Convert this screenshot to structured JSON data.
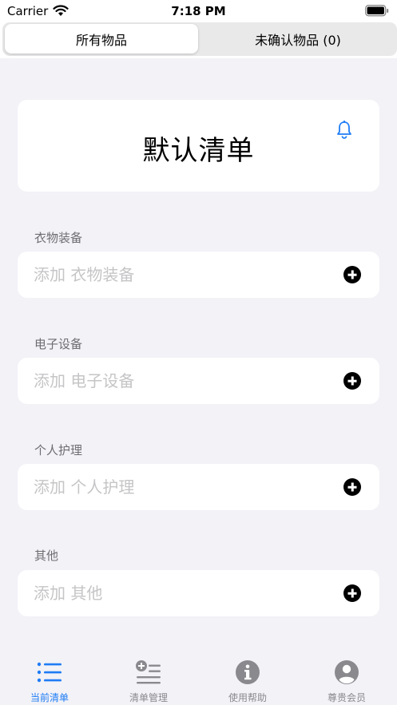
{
  "status_bar": {
    "carrier": "Carrier",
    "time": "7:18 PM"
  },
  "segment": {
    "left": "所有物品",
    "right": "未确认物品 (0)",
    "selected": "所有物品"
  },
  "list": {
    "title": "默认清单"
  },
  "sections": [
    {
      "label": "衣物装备",
      "placeholder": "添加 衣物装备"
    },
    {
      "label": "电子设备",
      "placeholder": "添加 电子设备"
    },
    {
      "label": "个人护理",
      "placeholder": "添加 个人护理"
    },
    {
      "label": "其他",
      "placeholder": "添加 其他"
    }
  ],
  "tabs": [
    {
      "label": "当前清单",
      "icon": "list-icon",
      "active": true
    },
    {
      "label": "清单管理",
      "icon": "list-add-icon",
      "active": false
    },
    {
      "label": "使用帮助",
      "icon": "info-icon",
      "active": false
    },
    {
      "label": "尊贵会员",
      "icon": "person-icon",
      "active": false
    }
  ],
  "colors": {
    "accent": "#1f7cf5",
    "background": "#f2f2f7",
    "inactive_tab": "#8a8a8e"
  }
}
